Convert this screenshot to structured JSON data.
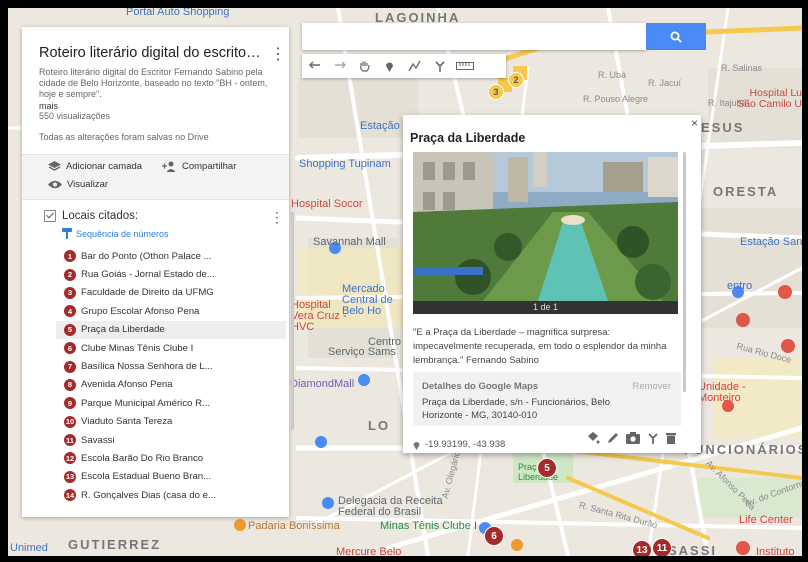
{
  "panel": {
    "title": "Roteiro literário digital do escritor Fernando Sabino",
    "description": "Roteiro literário digital do Escritor Fernando Sabino pela cidade de Belo Horizonte, baseado no texto \"BH - ontem, hoje e sempre\".",
    "more_label": "mais",
    "views": "550 visualizações",
    "saved_status": "Todas as alterações foram salvas no Drive",
    "add_layer_label": "Adicionar camada",
    "share_label": "Compartilhar",
    "preview_label": "Visualizar"
  },
  "layer": {
    "name": "Locais citados:",
    "style_label": "Sequência de números",
    "items": [
      {
        "num": "1",
        "label": "Bar do Ponto (Othon Palace ..."
      },
      {
        "num": "2",
        "label": "Rua Goiás - Jornal Estado de..."
      },
      {
        "num": "3",
        "label": "Faculdade de Direito da UFMG"
      },
      {
        "num": "4",
        "label": "Grupo Escolar Afonso Pena"
      },
      {
        "num": "5",
        "label": "Praça da Liberdade"
      },
      {
        "num": "6",
        "label": "Clube Minas Tênis Clube I"
      },
      {
        "num": "7",
        "label": "Basílica Nossa Senhora de L..."
      },
      {
        "num": "8",
        "label": "Avenida Afonso Pena"
      },
      {
        "num": "9",
        "label": "Parque Municipal Américo R..."
      },
      {
        "num": "10",
        "label": "Viaduto Santa Tereza"
      },
      {
        "num": "11",
        "label": "Savassi"
      },
      {
        "num": "12",
        "label": "Escola Barão Do Rio Branco"
      },
      {
        "num": "13",
        "label": "Escola Estadual Bueno Bran..."
      },
      {
        "num": "14",
        "label": "R. Gonçalves Dias (casa do e..."
      }
    ]
  },
  "card": {
    "title": "Praça da Liberdade",
    "photo_caption": "1 de 1",
    "quote": "\"E a Praça da Liberdade – magnífica surpresa: impecavelmente recuperada, em todo o esplendor da minha lembrança.\" Fernando Sabino",
    "details_header": "Detalhes do Google Maps",
    "remove_label": "Remover",
    "address": "Praça da Liberdade, s/n - Funcionários, Belo Horizonte - MG, 30140-010",
    "coordinates": "-19.93199, -43.938",
    "close_glyph": "×"
  },
  "map_labels": {
    "portal": "Portal Auto Shopping",
    "lagoinha": "LAGOINHA",
    "r_salinas": "R. Salinas",
    "r_uba": "R. Ubá",
    "r_pouso_alegre": "R. Pouso Alegre",
    "r_jacui": "R. Jacuí",
    "r_itajuba": "R. Itajubá",
    "hospital_camilo": "Hospital Lu São Camilo U",
    "estacao": "Estação",
    "esus": "ESUS",
    "shopping_tupinambas": "Shopping Tupinam",
    "floresta": "ORESTA",
    "hospital_socor": "Hospital Socor",
    "savannah": "Savannah Mall",
    "estacao_santa": "Estação Santa",
    "mercado": "Mercado Central de Belo Ho",
    "hospital_vera": "Hospital Vera Cruz - HVC",
    "centro": "Centro",
    "servico": "Serviço Sams",
    "diamond": "DiamondMall",
    "praca_label": "Praça da Liberdade",
    "unidade": "Unidade - Monteiro",
    "funcionarios": "FUNCIONÁRIOS",
    "delegacia": "Delegacia da Receita Federal do Brasil",
    "minas_tenis": "Minas Tênis Clube I",
    "padaria": "Padaria Bonissima",
    "gutierrez": "GUTIERREZ",
    "life_center": "Life Center",
    "unimed": "Unimed",
    "mercure": "Mercure Belo",
    "instituto": "Instituto",
    "lourdes": "LO",
    "savassi": "SASSI",
    "centro_right": "entro",
    "av_contorno": "Av. do Contorno",
    "av_olegario": "Av. Olegário Maciel",
    "r_santa_rita": "R. Santa Rita Durão",
    "av_afonso_pena": "Av. Afonso Pena",
    "r_rio_doce": "Rua Rio Doce"
  },
  "map_markers": [
    "2",
    "3",
    "5",
    "6",
    "13",
    "11"
  ],
  "colors": {
    "marker": "#a52a2a",
    "accent_blue": "#4a8af4",
    "map_background": "#ece8df"
  }
}
